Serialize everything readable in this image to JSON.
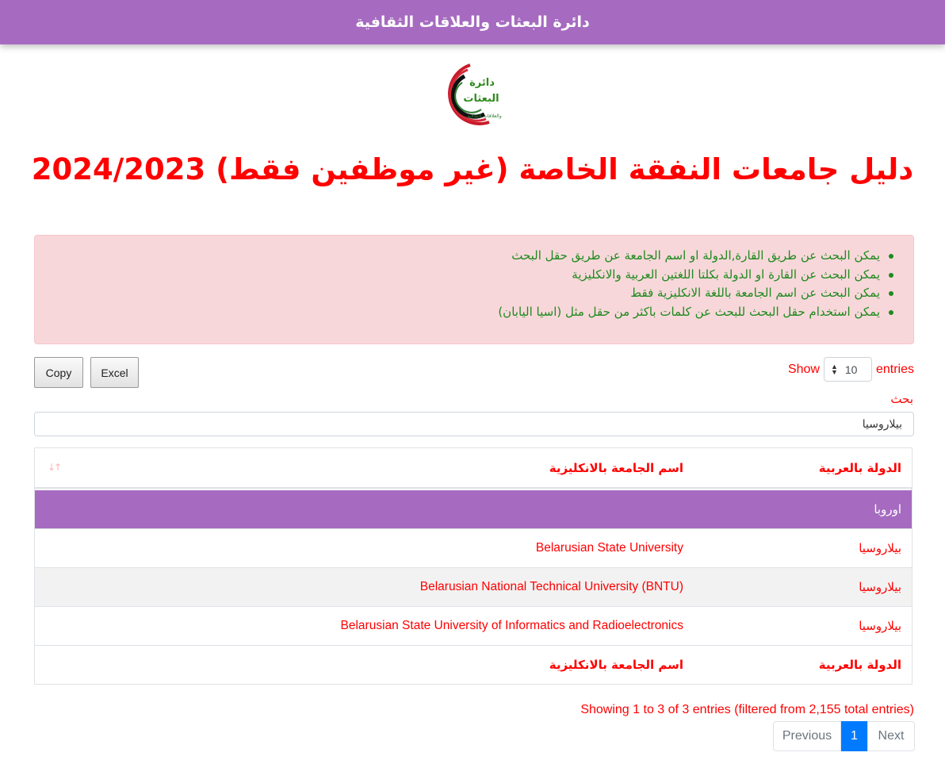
{
  "header": {
    "title": "دائرة البعثات والعلاقات الثقافية"
  },
  "logo": {
    "line1": "دائرة",
    "line2": "البعثات",
    "caption": "والعلاقات الثقافية"
  },
  "page_title": "دليل جامعات النفقة الخاصة (غير موظفين فقط) 2024/2023",
  "notes": [
    "يمكن البحث عن طريق القارة,الدولة او اسم الجامعة عن طريق حقل البحث",
    "يمكن البحث عن القارة او الدولة بكلتا اللغتين العربية والانكليزية",
    "يمكن البحث عن اسم الجامعة باللغة الانكليزية فقط",
    "يمكن استخدام حقل البحث للبحث عن كلمات باكثر من حقل مثل (اسيا اليابان)"
  ],
  "toolbar": {
    "copy": "Copy",
    "excel": "Excel"
  },
  "length": {
    "show": "Show",
    "value": "10",
    "entries": "entries"
  },
  "search": {
    "label": "بحث",
    "value": "بيلاروسيا"
  },
  "table": {
    "columns": [
      "الدولة بالعربية",
      "اسم الجامعة بالانكليزية"
    ],
    "group": "اوروبا",
    "rows": [
      {
        "country": "بيلاروسيا",
        "university": "Belarusian State University"
      },
      {
        "country": "بيلاروسيا",
        "university": "Belarusian National Technical University (BNTU)"
      },
      {
        "country": "بيلاروسيا",
        "university": "Belarusian State University of Informatics and Radioelectronics"
      }
    ]
  },
  "info": "Showing 1 to 3 of 3 entries (filtered from 2,155 total entries)",
  "pagination": {
    "previous": "Previous",
    "current": "1",
    "next": "Next"
  },
  "colors": {
    "primary": "#a66bc0",
    "accent_text": "#ff0000",
    "note_text": "#1e8a1e",
    "alert_bg": "#f8d7da",
    "page_active": "#007bff"
  }
}
